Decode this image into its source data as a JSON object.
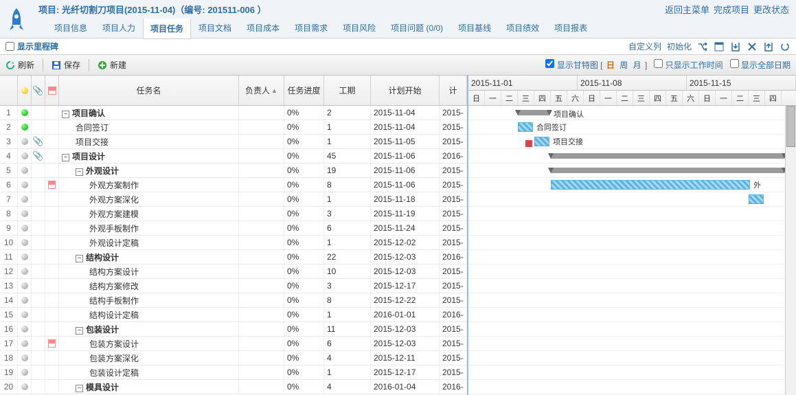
{
  "title": "项目: 光纤切割刀项目(2015-11-04)（编号: 201511-006 ）",
  "header_links": [
    "返回主菜单",
    "完成项目",
    "更改状态"
  ],
  "tabs": [
    "项目信息",
    "项目人力",
    "项目任务",
    "项目文档",
    "项目成本",
    "项目需求",
    "项目风险",
    "项目问题 (0/0)",
    "项目基线",
    "项目绩效",
    "项目报表"
  ],
  "active_tab": 2,
  "milestone_label": "显示里程碑",
  "subbar_links": [
    "自定义列",
    "初始化"
  ],
  "toolbar": {
    "refresh": "刷新",
    "save": "保存",
    "new": "新建"
  },
  "gantt_chk": "显示甘特图",
  "dwm": {
    "day": "日",
    "week": "周",
    "month": "月"
  },
  "workonly_chk": "只显示工作时间",
  "allday_chk": "显示全部日期",
  "columns": {
    "rownum": "",
    "status": "",
    "attach": "",
    "flag": "",
    "name": "任务名",
    "owner": "负责人",
    "progress": "任务进度",
    "dur": "工期",
    "start": "计划开始",
    "end": "计"
  },
  "weeks": [
    "2015-11-01",
    "2015-11-08",
    "2015-11-15"
  ],
  "days": [
    "日",
    "一",
    "二",
    "三",
    "四",
    "五",
    "六",
    "日",
    "一",
    "二",
    "三",
    "四",
    "五",
    "六",
    "日",
    "一",
    "二",
    "三",
    "四"
  ],
  "rows": [
    {
      "n": 1,
      "s": "green",
      "a": false,
      "f": false,
      "name": "项目确认",
      "lvl": 0,
      "t": true,
      "b": true,
      "p": "0%",
      "d": "2",
      "st": "2015-11-04",
      "en": "2015-"
    },
    {
      "n": 2,
      "s": "green",
      "a": false,
      "f": false,
      "name": "合同签订",
      "lvl": 1,
      "t": false,
      "b": false,
      "p": "0%",
      "d": "1",
      "st": "2015-11-04",
      "en": "2015-"
    },
    {
      "n": 3,
      "s": "gray",
      "a": true,
      "f": false,
      "name": "项目交接",
      "lvl": 1,
      "t": false,
      "b": false,
      "p": "0%",
      "d": "1",
      "st": "2015-11-05",
      "en": "2015-"
    },
    {
      "n": 4,
      "s": "gray",
      "a": true,
      "f": false,
      "name": "项目设计",
      "lvl": 0,
      "t": true,
      "b": true,
      "p": "0%",
      "d": "45",
      "st": "2015-11-06",
      "en": "2016-"
    },
    {
      "n": 5,
      "s": "gray",
      "a": false,
      "f": false,
      "name": "外观设计",
      "lvl": 1,
      "t": true,
      "b": true,
      "p": "0%",
      "d": "19",
      "st": "2015-11-06",
      "en": "2015-"
    },
    {
      "n": 6,
      "s": "gray",
      "a": false,
      "f": true,
      "name": "外观方案制作",
      "lvl": 2,
      "t": false,
      "b": false,
      "p": "0%",
      "d": "8",
      "st": "2015-11-06",
      "en": "2015-"
    },
    {
      "n": 7,
      "s": "gray",
      "a": false,
      "f": false,
      "name": "外观方案深化",
      "lvl": 2,
      "t": false,
      "b": false,
      "p": "0%",
      "d": "1",
      "st": "2015-11-18",
      "en": "2015-"
    },
    {
      "n": 8,
      "s": "gray",
      "a": false,
      "f": false,
      "name": "外观方案建模",
      "lvl": 2,
      "t": false,
      "b": false,
      "p": "0%",
      "d": "3",
      "st": "2015-11-19",
      "en": "2015-"
    },
    {
      "n": 9,
      "s": "gray",
      "a": false,
      "f": false,
      "name": "外观手板制作",
      "lvl": 2,
      "t": false,
      "b": false,
      "p": "0%",
      "d": "6",
      "st": "2015-11-24",
      "en": "2015-"
    },
    {
      "n": 10,
      "s": "gray",
      "a": false,
      "f": false,
      "name": "外观设计定稿",
      "lvl": 2,
      "t": false,
      "b": false,
      "p": "0%",
      "d": "1",
      "st": "2015-12-02",
      "en": "2015-"
    },
    {
      "n": 11,
      "s": "gray",
      "a": false,
      "f": false,
      "name": "结构设计",
      "lvl": 1,
      "t": true,
      "b": true,
      "p": "0%",
      "d": "22",
      "st": "2015-12-03",
      "en": "2016-"
    },
    {
      "n": 12,
      "s": "gray",
      "a": false,
      "f": false,
      "name": "结构方案设计",
      "lvl": 2,
      "t": false,
      "b": false,
      "p": "0%",
      "d": "10",
      "st": "2015-12-03",
      "en": "2015-"
    },
    {
      "n": 13,
      "s": "gray",
      "a": false,
      "f": false,
      "name": "结构方案修改",
      "lvl": 2,
      "t": false,
      "b": false,
      "p": "0%",
      "d": "3",
      "st": "2015-12-17",
      "en": "2015-"
    },
    {
      "n": 14,
      "s": "gray",
      "a": false,
      "f": false,
      "name": "结构手板制作",
      "lvl": 2,
      "t": false,
      "b": false,
      "p": "0%",
      "d": "8",
      "st": "2015-12-22",
      "en": "2015-"
    },
    {
      "n": 15,
      "s": "gray",
      "a": false,
      "f": false,
      "name": "结构设计定稿",
      "lvl": 2,
      "t": false,
      "b": false,
      "p": "0%",
      "d": "1",
      "st": "2016-01-01",
      "en": "2016-"
    },
    {
      "n": 16,
      "s": "gray",
      "a": false,
      "f": false,
      "name": "包装设计",
      "lvl": 1,
      "t": true,
      "b": true,
      "p": "0%",
      "d": "11",
      "st": "2015-12-03",
      "en": "2015-"
    },
    {
      "n": 17,
      "s": "gray",
      "a": false,
      "f": true,
      "name": "包装方案设计",
      "lvl": 2,
      "t": false,
      "b": false,
      "p": "0%",
      "d": "6",
      "st": "2015-12-03",
      "en": "2015-"
    },
    {
      "n": 18,
      "s": "gray",
      "a": false,
      "f": false,
      "name": "包装方案深化",
      "lvl": 2,
      "t": false,
      "b": false,
      "p": "0%",
      "d": "4",
      "st": "2015-12-11",
      "en": "2015-"
    },
    {
      "n": 19,
      "s": "gray",
      "a": false,
      "f": false,
      "name": "包装设计定稿",
      "lvl": 2,
      "t": false,
      "b": false,
      "p": "0%",
      "d": "1",
      "st": "2015-12-17",
      "en": "2015-"
    },
    {
      "n": 20,
      "s": "gray",
      "a": false,
      "f": false,
      "name": "模具设计",
      "lvl": 1,
      "t": true,
      "b": true,
      "p": "0%",
      "d": "4",
      "st": "2016-01-04",
      "en": "2016-"
    }
  ],
  "gantt_labels": {
    "r1": "项目确认",
    "r2": "合同签订",
    "r3": "项目交接",
    "r6": "外"
  }
}
